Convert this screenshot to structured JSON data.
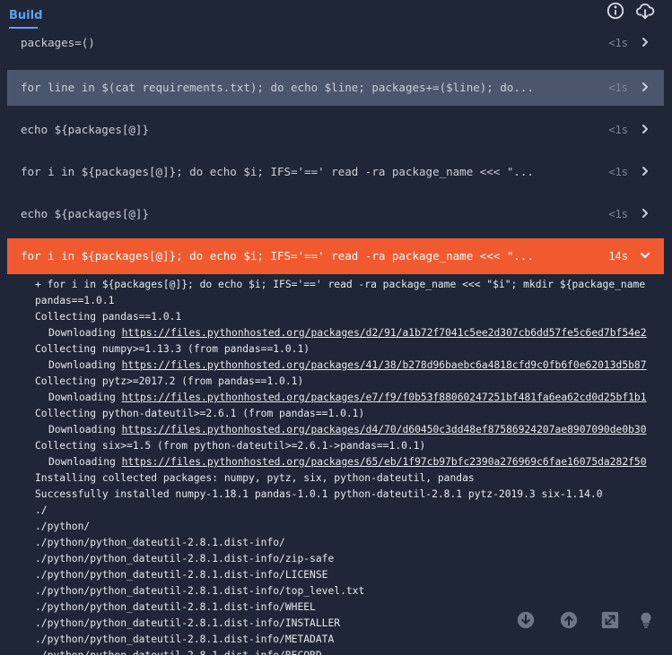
{
  "header": {
    "tab_build": "Build",
    "icons": {
      "info": "info-icon",
      "download": "cloud-download-icon"
    }
  },
  "colors": {
    "accent": "#5ba2f0",
    "active_step": "#f15a2f",
    "selected_step": "#4b556b",
    "background": "#1f2637"
  },
  "steps": [
    {
      "command": "packages=()",
      "duration": "<1s",
      "state": "normal"
    },
    {
      "command": "for line in $(cat requirements.txt); do echo $line; packages+=($line); do...",
      "duration": "<1s",
      "state": "selected"
    },
    {
      "command": "echo ${packages[@]}",
      "duration": "<1s",
      "state": "normal"
    },
    {
      "command": "for i in ${packages[@]}; do echo $i; IFS='==' read -ra package_name <<< \"...",
      "duration": "<1s",
      "state": "normal"
    },
    {
      "command": "echo ${packages[@]}",
      "duration": "<1s",
      "state": "normal"
    },
    {
      "command": "for i in ${packages[@]}; do echo $i; IFS='==' read -ra package_name <<< \"...",
      "duration": "14s",
      "state": "active"
    }
  ],
  "log": [
    {
      "text": "+ for i in ${packages[@]}; do echo $i; IFS='==' read -ra package_name <<< \"$i\"; mkdir ${package_name"
    },
    {
      "text": "pandas==1.0.1"
    },
    {
      "text": "Collecting pandas==1.0.1"
    },
    {
      "prefix": "Downloading ",
      "link": "https://files.pythonhosted.org/packages/d2/91/a1b72f7041c5ee2d307cb6dd57fe5c6ed7bf54e2"
    },
    {
      "text": "Collecting numpy>=1.13.3 (from pandas==1.0.1)"
    },
    {
      "prefix": "Downloading ",
      "link": "https://files.pythonhosted.org/packages/41/38/b278d96baebc6a4818cfd9c0fb6f0e62013d5b87"
    },
    {
      "text": "Collecting pytz>=2017.2 (from pandas==1.0.1)"
    },
    {
      "prefix": "Downloading ",
      "link": "https://files.pythonhosted.org/packages/e7/f9/f0b53f88060247251bf481fa6ea62cd0d25bf1b1"
    },
    {
      "text": "Collecting python-dateutil>=2.6.1 (from pandas==1.0.1)"
    },
    {
      "prefix": "Downloading ",
      "link": "https://files.pythonhosted.org/packages/d4/70/d60450c3dd48ef87586924207ae8907090de0b30"
    },
    {
      "text": "Collecting six>=1.5 (from python-dateutil>=2.6.1->pandas==1.0.1)"
    },
    {
      "prefix": "Downloading ",
      "link": "https://files.pythonhosted.org/packages/65/eb/1f97cb97bfc2390a276969c6fae16075da282f50"
    },
    {
      "text": "Installing collected packages: numpy, pytz, six, python-dateutil, pandas"
    },
    {
      "text": "Successfully installed numpy-1.18.1 pandas-1.0.1 python-dateutil-2.8.1 pytz-2019.3 six-1.14.0"
    },
    {
      "text": "./"
    },
    {
      "text": "./python/"
    },
    {
      "text": "./python/python_dateutil-2.8.1.dist-info/"
    },
    {
      "text": "./python/python_dateutil-2.8.1.dist-info/zip-safe"
    },
    {
      "text": "./python/python_dateutil-2.8.1.dist-info/LICENSE"
    },
    {
      "text": "./python/python_dateutil-2.8.1.dist-info/top_level.txt"
    },
    {
      "text": "./python/python_dateutil-2.8.1.dist-info/WHEEL"
    },
    {
      "text": "./python/python_dateutil-2.8.1.dist-info/INSTALLER"
    },
    {
      "text": "./python/python_dateutil-2.8.1.dist-info/METADATA"
    },
    {
      "text": "./python/python_dateutil-2.8.1.dist-info/RECORD"
    }
  ],
  "floating": {
    "icons": [
      "arrow-down-circle-icon",
      "arrow-up-circle-icon",
      "expand-icon",
      "lightbulb-icon"
    ]
  }
}
